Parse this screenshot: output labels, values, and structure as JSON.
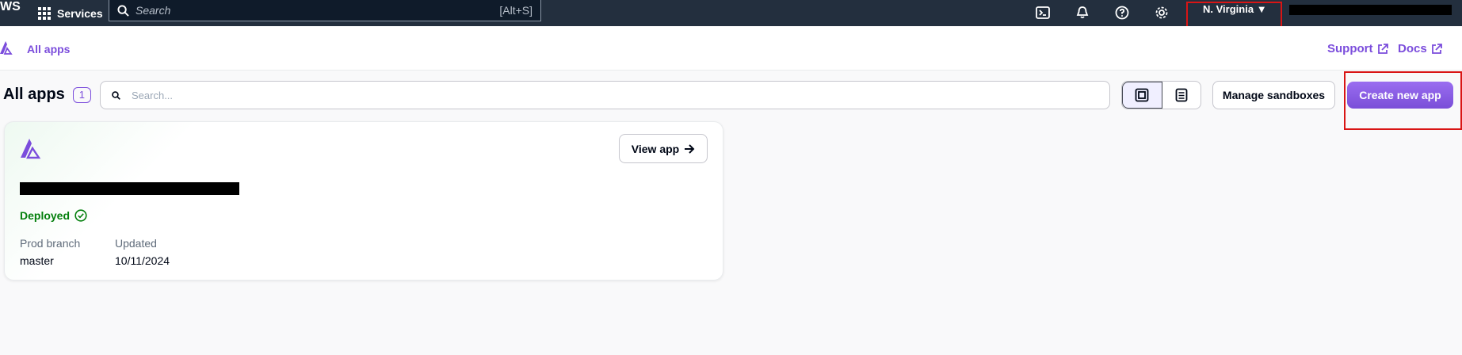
{
  "topnav": {
    "logo_text": "WS",
    "services_label": "Services",
    "search_placeholder": "Search",
    "search_shortcut": "[Alt+S]",
    "icons": [
      "cloudshell-icon",
      "bell-icon",
      "help-icon",
      "gear-icon"
    ],
    "region": "N. Virginia"
  },
  "subheader": {
    "breadcrumb": "All apps",
    "support_label": "Support",
    "docs_label": "Docs"
  },
  "toolbar": {
    "title": "All apps",
    "count": "1",
    "search_placeholder": "Search...",
    "manage_sandboxes_label": "Manage sandboxes",
    "create_app_label": "Create new app"
  },
  "apps": [
    {
      "view_label": "View app",
      "status": "Deployed",
      "prod_branch_label": "Prod branch",
      "prod_branch_value": "master",
      "updated_label": "Updated",
      "updated_value": "10/11/2024"
    }
  ],
  "colors": {
    "nav_bg": "#232f3e",
    "accent": "#7b4ddc",
    "success": "#037f0c",
    "highlight_box": "#d91515"
  }
}
